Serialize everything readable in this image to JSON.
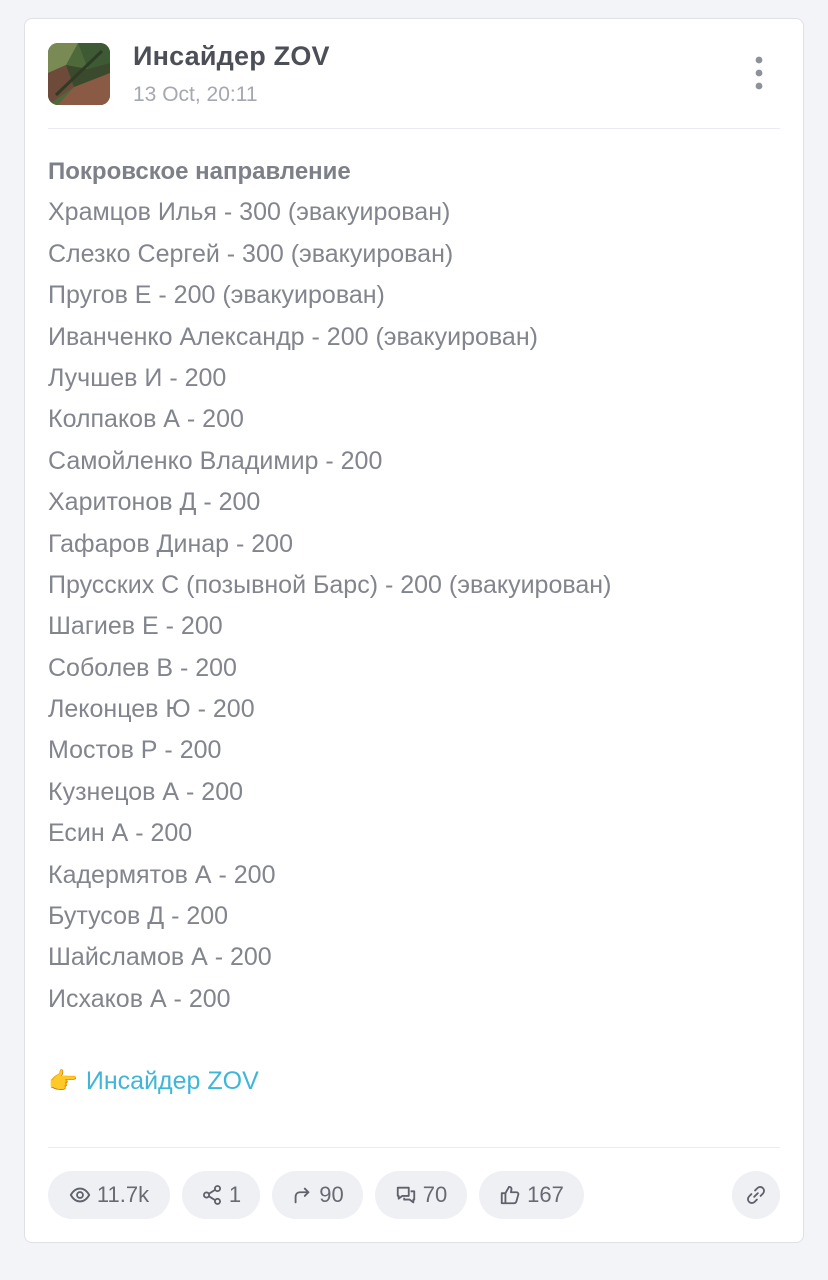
{
  "post": {
    "channel_name": "Инсайдер ZOV",
    "date": "13 Oct, 20:11",
    "heading": "Покровское направление",
    "lines": [
      "Храмцов Илья - 300 (эвакуирован)",
      "Слезко Сергей - 300 (эвакуирован)",
      "Пругов Е - 200 (эвакуирован)",
      "Иванченко Александр - 200 (эвакуирован)",
      "Лучшев И - 200",
      "Колпаков А - 200",
      "Самойленко Владимир - 200",
      "Харитонов Д - 200",
      "Гафаров Динар - 200",
      "Прусских С (позывной Барс) - 200 (эвакуирован)",
      "Шагиев Е - 200",
      "Соболев В - 200",
      "Леконцев Ю - 200",
      "Мостов Р - 200",
      "Кузнецов А - 200",
      "Есин А - 200",
      "Кадермятов А - 200",
      "Бутусов Д - 200",
      "Шайсламов А - 200",
      "Исхаков А - 200"
    ],
    "source_emoji": "👉",
    "source_link_text": "Инсайдер ZOV"
  },
  "stats": {
    "views": "11.7k",
    "shares": "1",
    "forwards": "90",
    "comments": "70",
    "reactions": "167"
  },
  "icons": {
    "menu": "more-vertical-icon",
    "views": "eye-icon",
    "shares": "share-nodes-icon",
    "forwards": "forward-arrow-icon",
    "comments": "comments-icon",
    "reactions": "thumbs-up-icon",
    "link": "link-icon"
  },
  "colors": {
    "link": "#3fb6d8",
    "text": "#82858d",
    "pill_bg": "#eef0f4"
  }
}
